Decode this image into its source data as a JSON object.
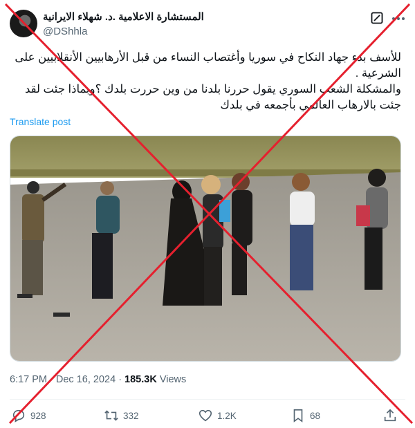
{
  "author": {
    "name": "المستشارة الاعلامية .د. شهلاء الايرانية",
    "handle": "@DShhla"
  },
  "icons": {
    "grok": "grok-icon",
    "more": "more-icon",
    "reply": "reply-icon",
    "retweet": "retweet-icon",
    "like": "heart-icon",
    "bookmark": "bookmark-icon",
    "share": "share-icon"
  },
  "tweet": {
    "line1": "للأسف بدء جهاد النكاح في سوريا وأغتصاب النساء من قبل الأرهابيين الأنقلابيين على الشرعية .",
    "line2": "والمشكلة الشعب السوري يقول حررنا بلدنا من وين حررت بلدك ؟وبماذا جئت لقد جئت بالارهاب العالمي بأجمعه في بلدك"
  },
  "translate_label": "Translate post",
  "meta": {
    "time": "6:17 PM",
    "date": "Dec 16, 2024",
    "views_count": "185.3K",
    "views_label": "Views"
  },
  "actions": {
    "replies": "928",
    "reposts": "332",
    "likes": "1.2K",
    "bookmarks": "68"
  },
  "colors": {
    "text": "#0f1419",
    "muted": "#536471",
    "link": "#1d9bf0",
    "cross": "#e5202e"
  }
}
